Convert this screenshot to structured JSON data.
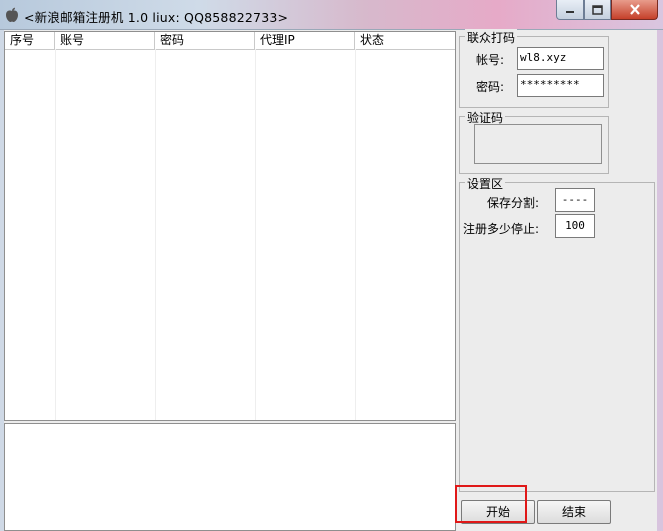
{
  "window": {
    "title": "<新浪邮箱注册机  1.0  liux: QQ858822733>"
  },
  "table": {
    "columns": [
      "序号",
      "账号",
      "密码",
      "代理IP",
      "状态"
    ],
    "rows": []
  },
  "dama_group": {
    "label": "联众打码",
    "account_label": "帐号:",
    "account_value": "wl8.xyz",
    "password_label": "密码:",
    "password_value": "*********"
  },
  "captcha_group": {
    "label": "验证码"
  },
  "settings_group": {
    "label": "设置区",
    "separator_label": "保存分割:",
    "separator_value": "----",
    "stop_label": "注册多少停止:",
    "stop_value": "100"
  },
  "buttons": {
    "start": "开始",
    "end": "结束"
  },
  "colors": {
    "highlight": "#e01818",
    "close_button": "#c5402a"
  }
}
